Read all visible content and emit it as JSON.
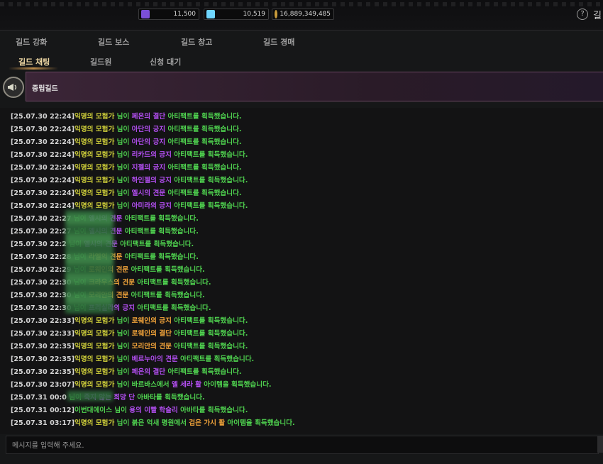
{
  "currencies": [
    {
      "icon": "purple-crystal-icon",
      "value": "11,500",
      "color": "#8a5cff"
    },
    {
      "icon": "blue-gem-icon",
      "value": "10,519",
      "color": "#6fd6ff"
    },
    {
      "icon": "gold-coin-icon",
      "value": "16,889,349,485",
      "color": "#c99b3b"
    }
  ],
  "header": {
    "help_glyph": "?",
    "help_trunc": "길"
  },
  "tabs_primary": [
    "길드 강화",
    "길드 보스",
    "길드 창고",
    "길드 경매"
  ],
  "tabs_secondary": [
    "길드 채팅",
    "길드원",
    "신청 대기"
  ],
  "guild": {
    "name": "중립길드"
  },
  "chat": [
    [
      {
        "t": "[25.07.30 22:24]",
        "c": "ts"
      },
      {
        "t": "익명의 모험가",
        "c": "nm"
      },
      {
        "t": " 님이 ",
        "c": "g"
      },
      {
        "t": "페온의 결단",
        "c": "p"
      },
      {
        "t": " 아티팩트를 획득했습니다.",
        "c": "g"
      }
    ],
    [
      {
        "t": "[25.07.30 22:24]",
        "c": "ts"
      },
      {
        "t": "익명의 모험가",
        "c": "nm"
      },
      {
        "t": " 님이 ",
        "c": "g"
      },
      {
        "t": "아단의 긍지",
        "c": "p"
      },
      {
        "t": " 아티팩트를 획득했습니다.",
        "c": "g"
      }
    ],
    [
      {
        "t": "[25.07.30 22:24]",
        "c": "ts"
      },
      {
        "t": "익명의 모험가",
        "c": "nm"
      },
      {
        "t": " 님이 ",
        "c": "g"
      },
      {
        "t": "아단의 긍지",
        "c": "p"
      },
      {
        "t": " 아티팩트를 획득했습니다.",
        "c": "g"
      }
    ],
    [
      {
        "t": "[25.07.30 22:24]",
        "c": "ts"
      },
      {
        "t": "익명의 모험가",
        "c": "nm"
      },
      {
        "t": " 님이 ",
        "c": "g"
      },
      {
        "t": "리카드의 긍지",
        "c": "p"
      },
      {
        "t": " 아티팩트를 획득했습니다.",
        "c": "g"
      }
    ],
    [
      {
        "t": "[25.07.30 22:24]",
        "c": "ts"
      },
      {
        "t": "익명의 모험가",
        "c": "nm"
      },
      {
        "t": " 님이 ",
        "c": "g"
      },
      {
        "t": "지젤의 긍지",
        "c": "p"
      },
      {
        "t": " 아티팩트를 획득했습니다.",
        "c": "g"
      }
    ],
    [
      {
        "t": "[25.07.30 22:24]",
        "c": "ts"
      },
      {
        "t": "익명의 모험가",
        "c": "nm"
      },
      {
        "t": " 님이 ",
        "c": "g"
      },
      {
        "t": "하인젤의 긍지",
        "c": "p"
      },
      {
        "t": " 아티팩트를 획득했습니다.",
        "c": "g"
      }
    ],
    [
      {
        "t": "[25.07.30 22:24]",
        "c": "ts"
      },
      {
        "t": "익명의 모험가",
        "c": "nm"
      },
      {
        "t": " 님이 ",
        "c": "g"
      },
      {
        "t": "엘시의 견문",
        "c": "p"
      },
      {
        "t": " 아티팩트를 획득했습니다.",
        "c": "g"
      }
    ],
    [
      {
        "t": "[25.07.30 22:24]",
        "c": "ts"
      },
      {
        "t": "익명의 모험가",
        "c": "nm"
      },
      {
        "t": " 님이 ",
        "c": "g"
      },
      {
        "t": "아미라의 긍지",
        "c": "p"
      },
      {
        "t": " 아티팩트를 획득했습니다.",
        "c": "g"
      }
    ],
    [
      {
        "t": "[25.07.30 22:27",
        "c": "ts"
      },
      {
        "t": " 님이 ",
        "c": "g"
      },
      {
        "t": "엘시의 견문",
        "c": "p"
      },
      {
        "t": " 아티팩트를 획득했습니다.",
        "c": "g"
      }
    ],
    [
      {
        "t": "[25.07.30 22:27",
        "c": "ts"
      },
      {
        "t": " 님이 ",
        "c": "g"
      },
      {
        "t": "엘시의 견문",
        "c": "p"
      },
      {
        "t": " 아티팩트를 획득했습니다.",
        "c": "g"
      }
    ],
    [
      {
        "t": "[25.07.30 22:2",
        "c": "ts"
      },
      {
        "t": " 님이 ",
        "c": "g"
      },
      {
        "t": "엘시의 견문",
        "c": "p"
      },
      {
        "t": " 아티팩트를 획득했습니다.",
        "c": "g"
      }
    ],
    [
      {
        "t": "[25.07.30 22:28",
        "c": "ts"
      },
      {
        "t": " 님이 ",
        "c": "g"
      },
      {
        "t": "라엘의 견문",
        "c": "o"
      },
      {
        "t": " 아티팩트를 획득했습니다.",
        "c": "g"
      }
    ],
    [
      {
        "t": "[25.07.30 22:29",
        "c": "ts"
      },
      {
        "t": " 님이 ",
        "c": "g"
      },
      {
        "t": "로웨인의 견문",
        "c": "o"
      },
      {
        "t": " 아티팩트를 획득했습니다.",
        "c": "g"
      }
    ],
    [
      {
        "t": "[25.07.30 22:30",
        "c": "ts"
      },
      {
        "t": " 님이 ",
        "c": "g"
      },
      {
        "t": "크라우스의 견문",
        "c": "o"
      },
      {
        "t": " 아티팩트를 획득했습니다.",
        "c": "g"
      }
    ],
    [
      {
        "t": "[25.07.30 22:30",
        "c": "ts"
      },
      {
        "t": " 님이 ",
        "c": "g"
      },
      {
        "t": "모리안의 견문",
        "c": "o"
      },
      {
        "t": " 아티팩트를 획득했습니다.",
        "c": "g"
      }
    ],
    [
      {
        "t": "[25.07.30 22:30",
        "c": "ts"
      },
      {
        "t": " 님이 ",
        "c": "g"
      },
      {
        "t": "프리실라의 긍지",
        "c": "p"
      },
      {
        "t": " 아티팩트를 획득했습니다.",
        "c": "g"
      }
    ],
    [
      {
        "t": "[25.07.30 22:33]",
        "c": "ts"
      },
      {
        "t": "익명의 모험가",
        "c": "nm"
      },
      {
        "t": " 님이 ",
        "c": "g"
      },
      {
        "t": "로웨인의 긍지",
        "c": "o"
      },
      {
        "t": " 아티팩트를 획득했습니다.",
        "c": "g"
      }
    ],
    [
      {
        "t": "[25.07.30 22:33]",
        "c": "ts"
      },
      {
        "t": "익명의 모험가",
        "c": "nm"
      },
      {
        "t": " 님이 ",
        "c": "g"
      },
      {
        "t": "로웨인의 결단",
        "c": "o"
      },
      {
        "t": " 아티팩트를 획득했습니다.",
        "c": "g"
      }
    ],
    [
      {
        "t": "[25.07.30 22:35]",
        "c": "ts"
      },
      {
        "t": "익명의 모험가",
        "c": "nm"
      },
      {
        "t": " 님이 ",
        "c": "g"
      },
      {
        "t": "모리안의 견문",
        "c": "o"
      },
      {
        "t": " 아티팩트를 획득했습니다.",
        "c": "g"
      }
    ],
    [
      {
        "t": "[25.07.30 22:35]",
        "c": "ts"
      },
      {
        "t": "익명의 모험가",
        "c": "nm"
      },
      {
        "t": " 님이 ",
        "c": "g"
      },
      {
        "t": "베르누아의 견문",
        "c": "p"
      },
      {
        "t": " 아티팩트를 획득했습니다.",
        "c": "g"
      }
    ],
    [
      {
        "t": "[25.07.30 22:35]",
        "c": "ts"
      },
      {
        "t": "익명의 모험가",
        "c": "nm"
      },
      {
        "t": " 님이 ",
        "c": "g"
      },
      {
        "t": "페온의 결단",
        "c": "p"
      },
      {
        "t": " 아티팩트를 획득했습니다.",
        "c": "g"
      }
    ],
    [
      {
        "t": "[25.07.30 23:07]",
        "c": "ts"
      },
      {
        "t": "익명의 모험가",
        "c": "nm"
      },
      {
        "t": " 님이 바르바스에서 ",
        "c": "g"
      },
      {
        "t": "엘 세라 활",
        "c": "p"
      },
      {
        "t": " 아이템을 획득했습니다.",
        "c": "g"
      }
    ],
    [
      {
        "t": "[25.07.31 00:0",
        "c": "ts"
      },
      {
        "t": " 님이 ",
        "c": "g"
      },
      {
        "t": "죽지 않는 희망 단",
        "c": "p"
      },
      {
        "t": " 아바타를 획득했습니다.",
        "c": "g"
      }
    ],
    [
      {
        "t": "[25.07.31 00:12]",
        "c": "ts"
      },
      {
        "t": "이번대에이스 님이 ",
        "c": "g"
      },
      {
        "t": "용의 이빨 학슬리",
        "c": "p"
      },
      {
        "t": " 아바타를 획득했습니다.",
        "c": "g"
      }
    ],
    [
      {
        "t": "[25.07.31 03:17]",
        "c": "ts"
      },
      {
        "t": "익명의 모험가",
        "c": "nm"
      },
      {
        "t": " 님이 붉은 억새 평원에서 ",
        "c": "g"
      },
      {
        "t": "검은 가시 활",
        "c": "o"
      },
      {
        "t": " 아이템을 획득했습니다.",
        "c": "g"
      }
    ]
  ],
  "input": {
    "placeholder": "메시지를 입력해 주세요."
  }
}
